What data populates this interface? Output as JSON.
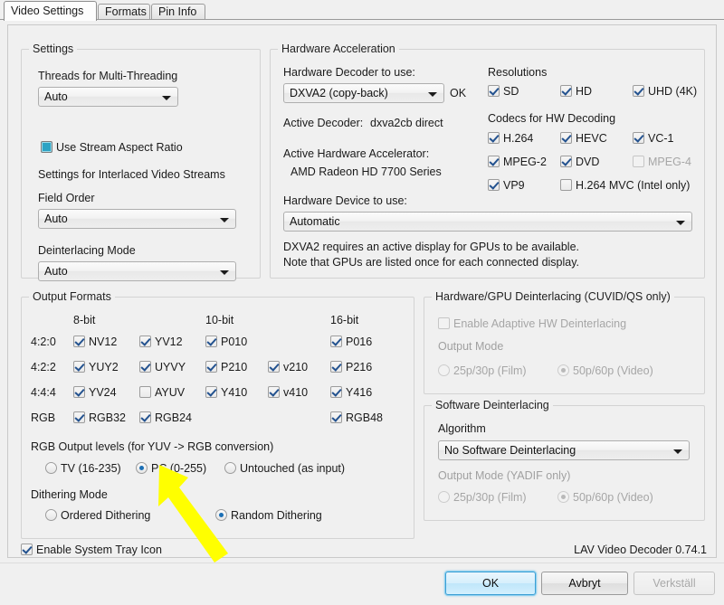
{
  "tabs": [
    {
      "label": "Video Settings",
      "active": true
    },
    {
      "label": "Formats",
      "active": false
    },
    {
      "label": "Pin Info",
      "active": false
    }
  ],
  "settings_group": {
    "legend": "Settings",
    "threads_label": "Threads for Multi-Threading",
    "threads_value": "Auto",
    "aspect_ratio_label": "Use Stream Aspect Ratio",
    "interlaced_header": "Settings for Interlaced Video Streams",
    "field_order_label": "Field Order",
    "field_order_value": "Auto",
    "deinterlacing_label": "Deinterlacing Mode",
    "deinterlacing_value": "Auto"
  },
  "hwaccel_group": {
    "legend": "Hardware Acceleration",
    "decoder_label": "Hardware Decoder to use:",
    "decoder_value": "DXVA2 (copy-back)",
    "decoder_status": "OK",
    "active_decoder_label": "Active Decoder:",
    "active_decoder_value": "dxva2cb direct",
    "active_accel_label": "Active Hardware Accelerator:",
    "active_accel_value": "AMD Radeon HD 7700 Series",
    "device_label": "Hardware Device to use:",
    "device_value": "Automatic",
    "note_line1": "DXVA2 requires an active display for GPUs to be available.",
    "note_line2": "Note that GPUs are listed once for each connected display.",
    "resolutions_label": "Resolutions",
    "resolutions": [
      {
        "label": "SD",
        "checked": true,
        "enabled": true
      },
      {
        "label": "HD",
        "checked": true,
        "enabled": true
      },
      {
        "label": "UHD (4K)",
        "checked": true,
        "enabled": true
      }
    ],
    "codecs_label": "Codecs for HW Decoding",
    "codecs": [
      {
        "label": "H.264",
        "checked": true,
        "enabled": true
      },
      {
        "label": "HEVC",
        "checked": true,
        "enabled": true
      },
      {
        "label": "VC-1",
        "checked": true,
        "enabled": true
      },
      {
        "label": "MPEG-2",
        "checked": true,
        "enabled": true
      },
      {
        "label": "DVD",
        "checked": true,
        "enabled": true
      },
      {
        "label": "MPEG-4",
        "checked": false,
        "enabled": false
      },
      {
        "label": "VP9",
        "checked": true,
        "enabled": true
      },
      {
        "label": "H.264 MVC (Intel only)",
        "checked": false,
        "enabled": true
      }
    ]
  },
  "output_formats_group": {
    "legend": "Output Formats",
    "col_headers": [
      "8-bit",
      "10-bit",
      "16-bit"
    ],
    "row_labels": [
      "4:2:0",
      "4:2:2",
      "4:4:4",
      "RGB"
    ],
    "formats": [
      {
        "label": "NV12",
        "checked": true
      },
      {
        "label": "YV12",
        "checked": true
      },
      {
        "label": "P010",
        "checked": true
      },
      {
        "label": "P016",
        "checked": true
      },
      {
        "label": "YUY2",
        "checked": true
      },
      {
        "label": "UYVY",
        "checked": true
      },
      {
        "label": "P210",
        "checked": true
      },
      {
        "label": "v210",
        "checked": true
      },
      {
        "label": "P216",
        "checked": true
      },
      {
        "label": "YV24",
        "checked": true
      },
      {
        "label": "AYUV",
        "checked": false
      },
      {
        "label": "Y410",
        "checked": true
      },
      {
        "label": "v410",
        "checked": true
      },
      {
        "label": "Y416",
        "checked": true
      },
      {
        "label": "RGB32",
        "checked": true
      },
      {
        "label": "RGB24",
        "checked": true
      },
      {
        "label": "RGB48",
        "checked": true
      }
    ],
    "rgb_levels_label": "RGB Output levels (for YUV -> RGB conversion)",
    "rgb_levels": [
      {
        "label": "TV (16-235)",
        "selected": false
      },
      {
        "label": "PC (0-255)",
        "selected": true
      },
      {
        "label": "Untouched (as input)",
        "selected": false
      }
    ],
    "dithering_label": "Dithering Mode",
    "dithering": [
      {
        "label": "Ordered Dithering",
        "selected": false
      },
      {
        "label": "Random Dithering",
        "selected": true
      }
    ]
  },
  "hw_deint_group": {
    "legend": "Hardware/GPU Deinterlacing (CUVID/QS only)",
    "enable_label": "Enable Adaptive HW Deinterlacing",
    "enable_checked": false,
    "output_mode_label": "Output Mode",
    "output_modes": [
      {
        "label": "25p/30p (Film)",
        "selected": false
      },
      {
        "label": "50p/60p (Video)",
        "selected": true
      }
    ]
  },
  "sw_deint_group": {
    "legend": "Software Deinterlacing",
    "algorithm_label": "Algorithm",
    "algorithm_value": "No Software Deinterlacing",
    "output_mode_label": "Output Mode (YADIF only)",
    "output_modes": [
      {
        "label": "25p/30p (Film)",
        "selected": false
      },
      {
        "label": "50p/60p (Video)",
        "selected": true
      }
    ]
  },
  "bottom": {
    "tray_label": "Enable System Tray Icon",
    "tray_checked": true,
    "version": "LAV Video Decoder 0.74.1"
  },
  "footer": {
    "ok_label": "OK",
    "cancel_label": "Avbryt",
    "apply_label": "Verkställ"
  },
  "annotation": {
    "color": "#ffff00",
    "type": "arrow-pointer"
  }
}
